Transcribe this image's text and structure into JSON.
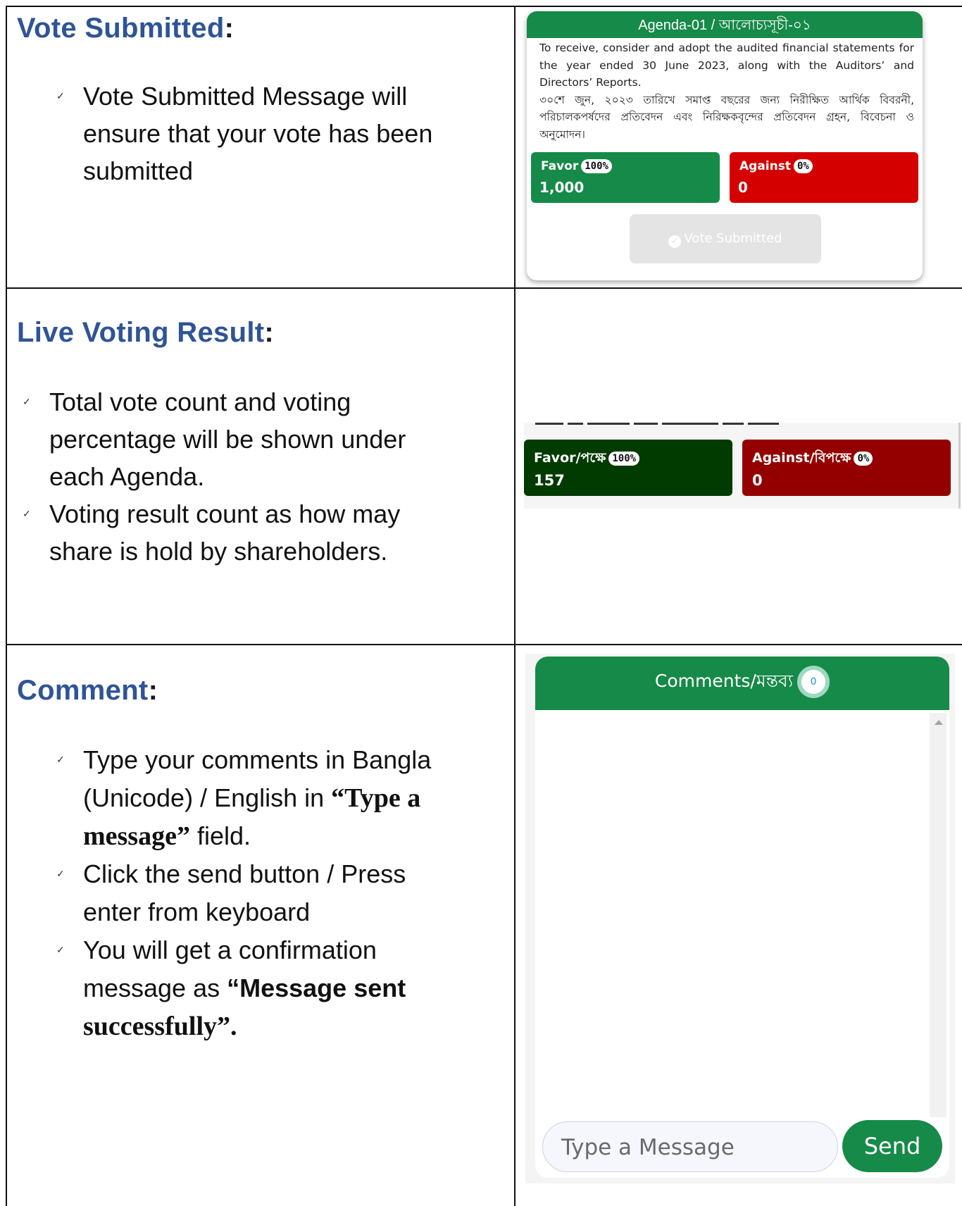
{
  "section1": {
    "heading": "Vote Submitted",
    "heading_colon": ":",
    "bullets": [
      [
        "Vote Submitted Message will",
        "ensure that your vote has been",
        "submitted"
      ]
    ]
  },
  "agenda_card": {
    "title": "Agenda-01 / আলোচ্যসূচী-০১",
    "description_en": "To receive, consider and adopt the audited financial statements for the year ended 30 June 2023, along with the Auditors’ and Directors’ Reports.",
    "description_bn": "৩০শে জুন, ২০২৩ তারিখে সমাপ্ত বছরের জন্য নিরীক্ষিত আর্থিক বিবরনী, পরিচালকপর্ষদের প্রতিবেদন এবং নিরিক্ষকবৃন্দের প্রতিবেদন গ্রহন, বিবেচনা ও অনুমোদন।",
    "favor_label": "Favor",
    "favor_percent": "100%",
    "favor_count": "1,000",
    "against_label": "Against",
    "against_percent": "0%",
    "against_count": "0",
    "vote_button": "Vote Submitted"
  },
  "section2": {
    "heading": "Live Voting Result",
    "heading_colon": ":",
    "bullets": [
      [
        "Total vote count and voting",
        "percentage will be shown under",
        "each Agenda."
      ],
      [
        "Voting result count as how may",
        "share is hold by shareholders."
      ]
    ]
  },
  "live_result": {
    "favor_label": "Favor/পক্ষে",
    "favor_percent": "100%",
    "favor_count": "157",
    "against_label": "Against/বিপক্ষে",
    "against_percent": "0%",
    "against_count": "0"
  },
  "section3": {
    "heading": "Comment",
    "heading_colon": ":",
    "b1_l1": "Type your comments in Bangla",
    "b1_l2a": "(Unicode) / English in ",
    "b1_l2b": "“Type a",
    "b1_l3a": "message”",
    "b1_l3b": " field.",
    "b2_l1": "Click the send button / Press",
    "b2_l2": "enter from keyboard",
    "b3_l1": "You will get a confirmation",
    "b3_l2a": "message as ",
    "b3_l2b": "“Message sent",
    "b3_l3": "successfully”."
  },
  "comments_panel": {
    "title": "Comments/মন্তব্য",
    "count": "0",
    "input_placeholder": "Type a Message",
    "send_label": "Send"
  },
  "colors": {
    "heading": "#2f5496",
    "green": "#168a48",
    "red": "#d40000",
    "dark_green": "#013b00",
    "dark_red": "#940000"
  }
}
